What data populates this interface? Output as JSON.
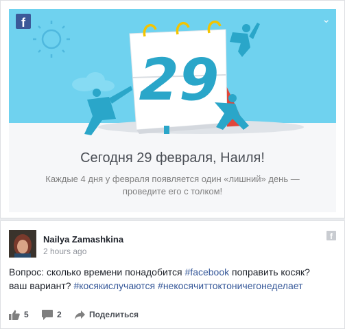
{
  "banner": {
    "calendar_date": "29",
    "headline": "Сегодня 29 февраля, Наиля!",
    "subline_1": "Каждые 4 дня у февраля появляется один «лишний» день —",
    "subline_2": "проведите его с толком!",
    "fb_logo_letter": "f",
    "colors": {
      "sky": "#6fd2ef",
      "accent": "#2aa6c9",
      "calendar_back": "#e0463a",
      "ring": "#f4c400"
    }
  },
  "post": {
    "author": "Nailya Zamashkina",
    "time": "2 hours ago",
    "text_part_1": "Вопрос: сколько времени понадобится ",
    "tag_1": "#facebook",
    "text_part_2": " поправить косяк?",
    "text_part_3": "ваш вариант? ",
    "tag_2": "#косякислучаются",
    "tag_3": "#некосячиттоктоничегонеделает",
    "fb_logo_letter": "f"
  },
  "actions": {
    "likes_count": "5",
    "comments_count": "2",
    "share_label": "Поделиться"
  }
}
